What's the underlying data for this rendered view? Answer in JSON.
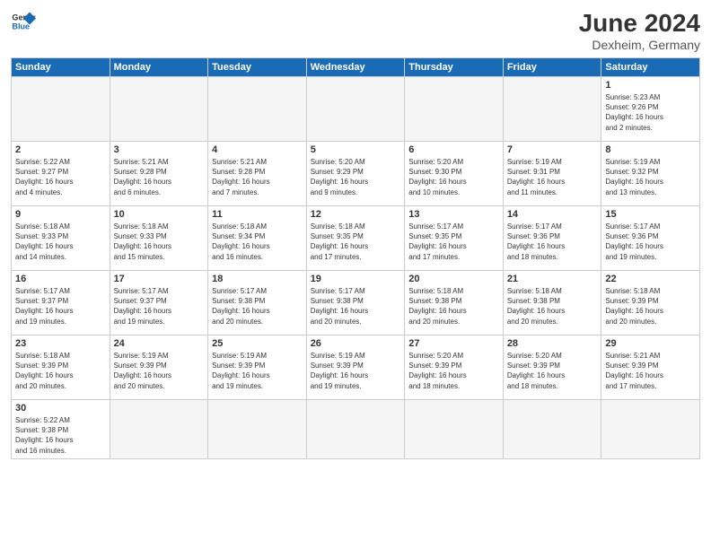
{
  "header": {
    "logo_general": "General",
    "logo_blue": "Blue",
    "month_year": "June 2024",
    "location": "Dexheim, Germany"
  },
  "weekdays": [
    "Sunday",
    "Monday",
    "Tuesday",
    "Wednesday",
    "Thursday",
    "Friday",
    "Saturday"
  ],
  "weeks": [
    [
      {
        "day": "",
        "info": ""
      },
      {
        "day": "",
        "info": ""
      },
      {
        "day": "",
        "info": ""
      },
      {
        "day": "",
        "info": ""
      },
      {
        "day": "",
        "info": ""
      },
      {
        "day": "",
        "info": ""
      },
      {
        "day": "1",
        "info": "Sunrise: 5:23 AM\nSunset: 9:26 PM\nDaylight: 16 hours\nand 2 minutes."
      }
    ],
    [
      {
        "day": "2",
        "info": "Sunrise: 5:22 AM\nSunset: 9:27 PM\nDaylight: 16 hours\nand 4 minutes."
      },
      {
        "day": "3",
        "info": "Sunrise: 5:21 AM\nSunset: 9:28 PM\nDaylight: 16 hours\nand 6 minutes."
      },
      {
        "day": "4",
        "info": "Sunrise: 5:21 AM\nSunset: 9:28 PM\nDaylight: 16 hours\nand 7 minutes."
      },
      {
        "day": "5",
        "info": "Sunrise: 5:20 AM\nSunset: 9:29 PM\nDaylight: 16 hours\nand 9 minutes."
      },
      {
        "day": "6",
        "info": "Sunrise: 5:20 AM\nSunset: 9:30 PM\nDaylight: 16 hours\nand 10 minutes."
      },
      {
        "day": "7",
        "info": "Sunrise: 5:19 AM\nSunset: 9:31 PM\nDaylight: 16 hours\nand 11 minutes."
      },
      {
        "day": "8",
        "info": "Sunrise: 5:19 AM\nSunset: 9:32 PM\nDaylight: 16 hours\nand 13 minutes."
      }
    ],
    [
      {
        "day": "9",
        "info": "Sunrise: 5:18 AM\nSunset: 9:33 PM\nDaylight: 16 hours\nand 14 minutes."
      },
      {
        "day": "10",
        "info": "Sunrise: 5:18 AM\nSunset: 9:33 PM\nDaylight: 16 hours\nand 15 minutes."
      },
      {
        "day": "11",
        "info": "Sunrise: 5:18 AM\nSunset: 9:34 PM\nDaylight: 16 hours\nand 16 minutes."
      },
      {
        "day": "12",
        "info": "Sunrise: 5:18 AM\nSunset: 9:35 PM\nDaylight: 16 hours\nand 17 minutes."
      },
      {
        "day": "13",
        "info": "Sunrise: 5:17 AM\nSunset: 9:35 PM\nDaylight: 16 hours\nand 17 minutes."
      },
      {
        "day": "14",
        "info": "Sunrise: 5:17 AM\nSunset: 9:36 PM\nDaylight: 16 hours\nand 18 minutes."
      },
      {
        "day": "15",
        "info": "Sunrise: 5:17 AM\nSunset: 9:36 PM\nDaylight: 16 hours\nand 19 minutes."
      }
    ],
    [
      {
        "day": "16",
        "info": "Sunrise: 5:17 AM\nSunset: 9:37 PM\nDaylight: 16 hours\nand 19 minutes."
      },
      {
        "day": "17",
        "info": "Sunrise: 5:17 AM\nSunset: 9:37 PM\nDaylight: 16 hours\nand 19 minutes."
      },
      {
        "day": "18",
        "info": "Sunrise: 5:17 AM\nSunset: 9:38 PM\nDaylight: 16 hours\nand 20 minutes."
      },
      {
        "day": "19",
        "info": "Sunrise: 5:17 AM\nSunset: 9:38 PM\nDaylight: 16 hours\nand 20 minutes."
      },
      {
        "day": "20",
        "info": "Sunrise: 5:18 AM\nSunset: 9:38 PM\nDaylight: 16 hours\nand 20 minutes."
      },
      {
        "day": "21",
        "info": "Sunrise: 5:18 AM\nSunset: 9:38 PM\nDaylight: 16 hours\nand 20 minutes."
      },
      {
        "day": "22",
        "info": "Sunrise: 5:18 AM\nSunset: 9:39 PM\nDaylight: 16 hours\nand 20 minutes."
      }
    ],
    [
      {
        "day": "23",
        "info": "Sunrise: 5:18 AM\nSunset: 9:39 PM\nDaylight: 16 hours\nand 20 minutes."
      },
      {
        "day": "24",
        "info": "Sunrise: 5:19 AM\nSunset: 9:39 PM\nDaylight: 16 hours\nand 20 minutes."
      },
      {
        "day": "25",
        "info": "Sunrise: 5:19 AM\nSunset: 9:39 PM\nDaylight: 16 hours\nand 19 minutes."
      },
      {
        "day": "26",
        "info": "Sunrise: 5:19 AM\nSunset: 9:39 PM\nDaylight: 16 hours\nand 19 minutes."
      },
      {
        "day": "27",
        "info": "Sunrise: 5:20 AM\nSunset: 9:39 PM\nDaylight: 16 hours\nand 18 minutes."
      },
      {
        "day": "28",
        "info": "Sunrise: 5:20 AM\nSunset: 9:39 PM\nDaylight: 16 hours\nand 18 minutes."
      },
      {
        "day": "29",
        "info": "Sunrise: 5:21 AM\nSunset: 9:39 PM\nDaylight: 16 hours\nand 17 minutes."
      }
    ],
    [
      {
        "day": "30",
        "info": "Sunrise: 5:22 AM\nSunset: 9:38 PM\nDaylight: 16 hours\nand 16 minutes."
      },
      {
        "day": "",
        "info": ""
      },
      {
        "day": "",
        "info": ""
      },
      {
        "day": "",
        "info": ""
      },
      {
        "day": "",
        "info": ""
      },
      {
        "day": "",
        "info": ""
      },
      {
        "day": "",
        "info": ""
      }
    ]
  ]
}
